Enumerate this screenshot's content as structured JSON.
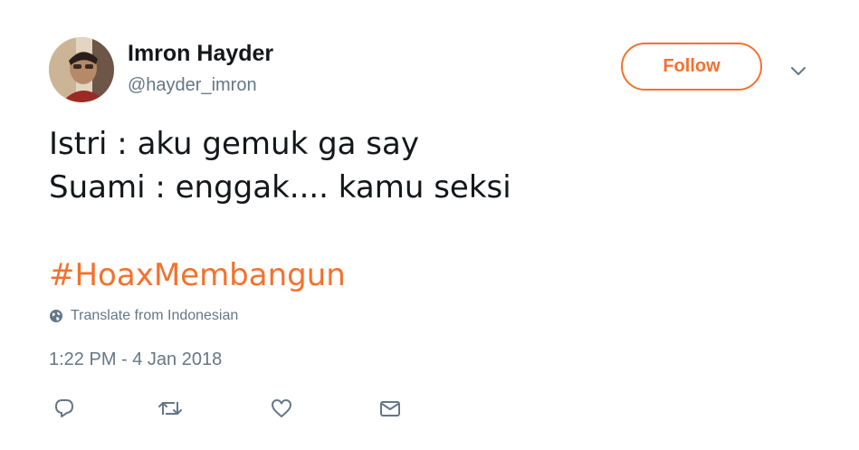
{
  "user": {
    "name": "Imron Hayder",
    "handle": "@hayder_imron",
    "avatar_icon": "user-avatar-photo"
  },
  "follow_label": "Follow",
  "menu_icon": "chevron-down-icon",
  "tweet": {
    "lines": [
      "Istri : aku gemuk ga say",
      "Suami : enggak.... kamu seksi"
    ],
    "hashtag": "#HoaxMembangun"
  },
  "translate_label": "Translate from Indonesian",
  "timestamp": "1:22 PM - 4 Jan 2018",
  "actions": [
    {
      "name": "reply",
      "icon": "reply-icon"
    },
    {
      "name": "retweet",
      "icon": "retweet-icon"
    },
    {
      "name": "like",
      "icon": "heart-icon"
    },
    {
      "name": "message",
      "icon": "envelope-icon"
    }
  ],
  "colors": {
    "accent": "#f5712c",
    "text": "#14171a",
    "secondary": "#657786"
  }
}
